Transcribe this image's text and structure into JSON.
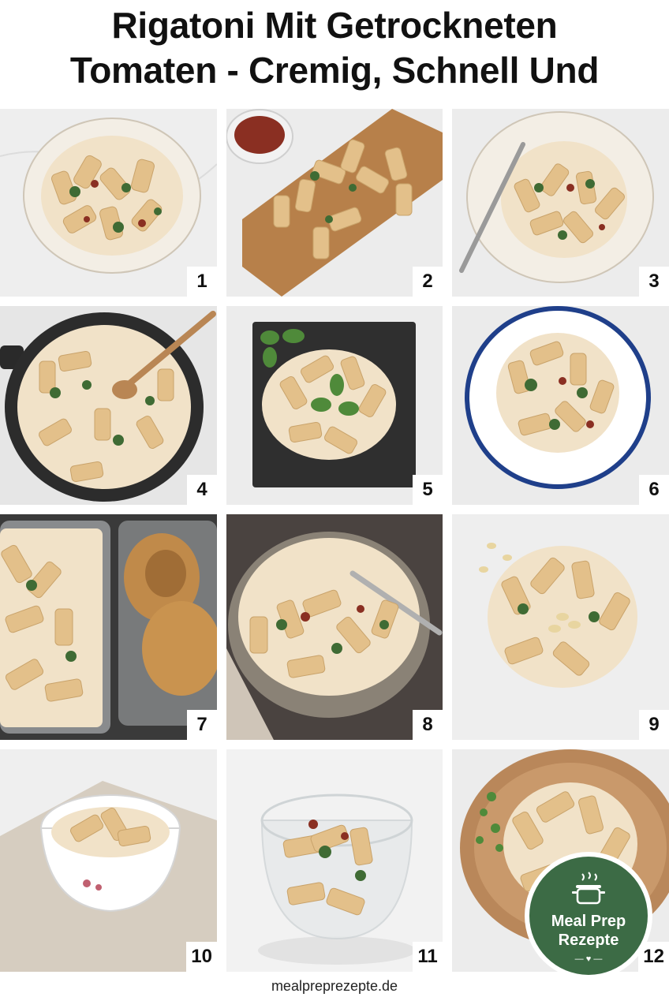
{
  "title": {
    "line1": "Rigatoni Mit Getrockneten",
    "line2": "Tomaten - Cremig, Schnell Und"
  },
  "tiles": [
    {
      "number": "1"
    },
    {
      "number": "2"
    },
    {
      "number": "3"
    },
    {
      "number": "4"
    },
    {
      "number": "5"
    },
    {
      "number": "6"
    },
    {
      "number": "7"
    },
    {
      "number": "8"
    },
    {
      "number": "9"
    },
    {
      "number": "10"
    },
    {
      "number": "11"
    },
    {
      "number": "12"
    }
  ],
  "badge": {
    "line1": "Meal Prep",
    "line2": "Rezepte",
    "icon": "cooking-pot-icon",
    "color": "#3c6b45"
  },
  "footer": {
    "url": "mealpreprezepte.de"
  },
  "colors": {
    "pasta": "#e8c996",
    "sauce": "#f1e2c8",
    "spinach": "#3f6b34",
    "tomato": "#8a2f22",
    "marble": "#eeeeee"
  }
}
